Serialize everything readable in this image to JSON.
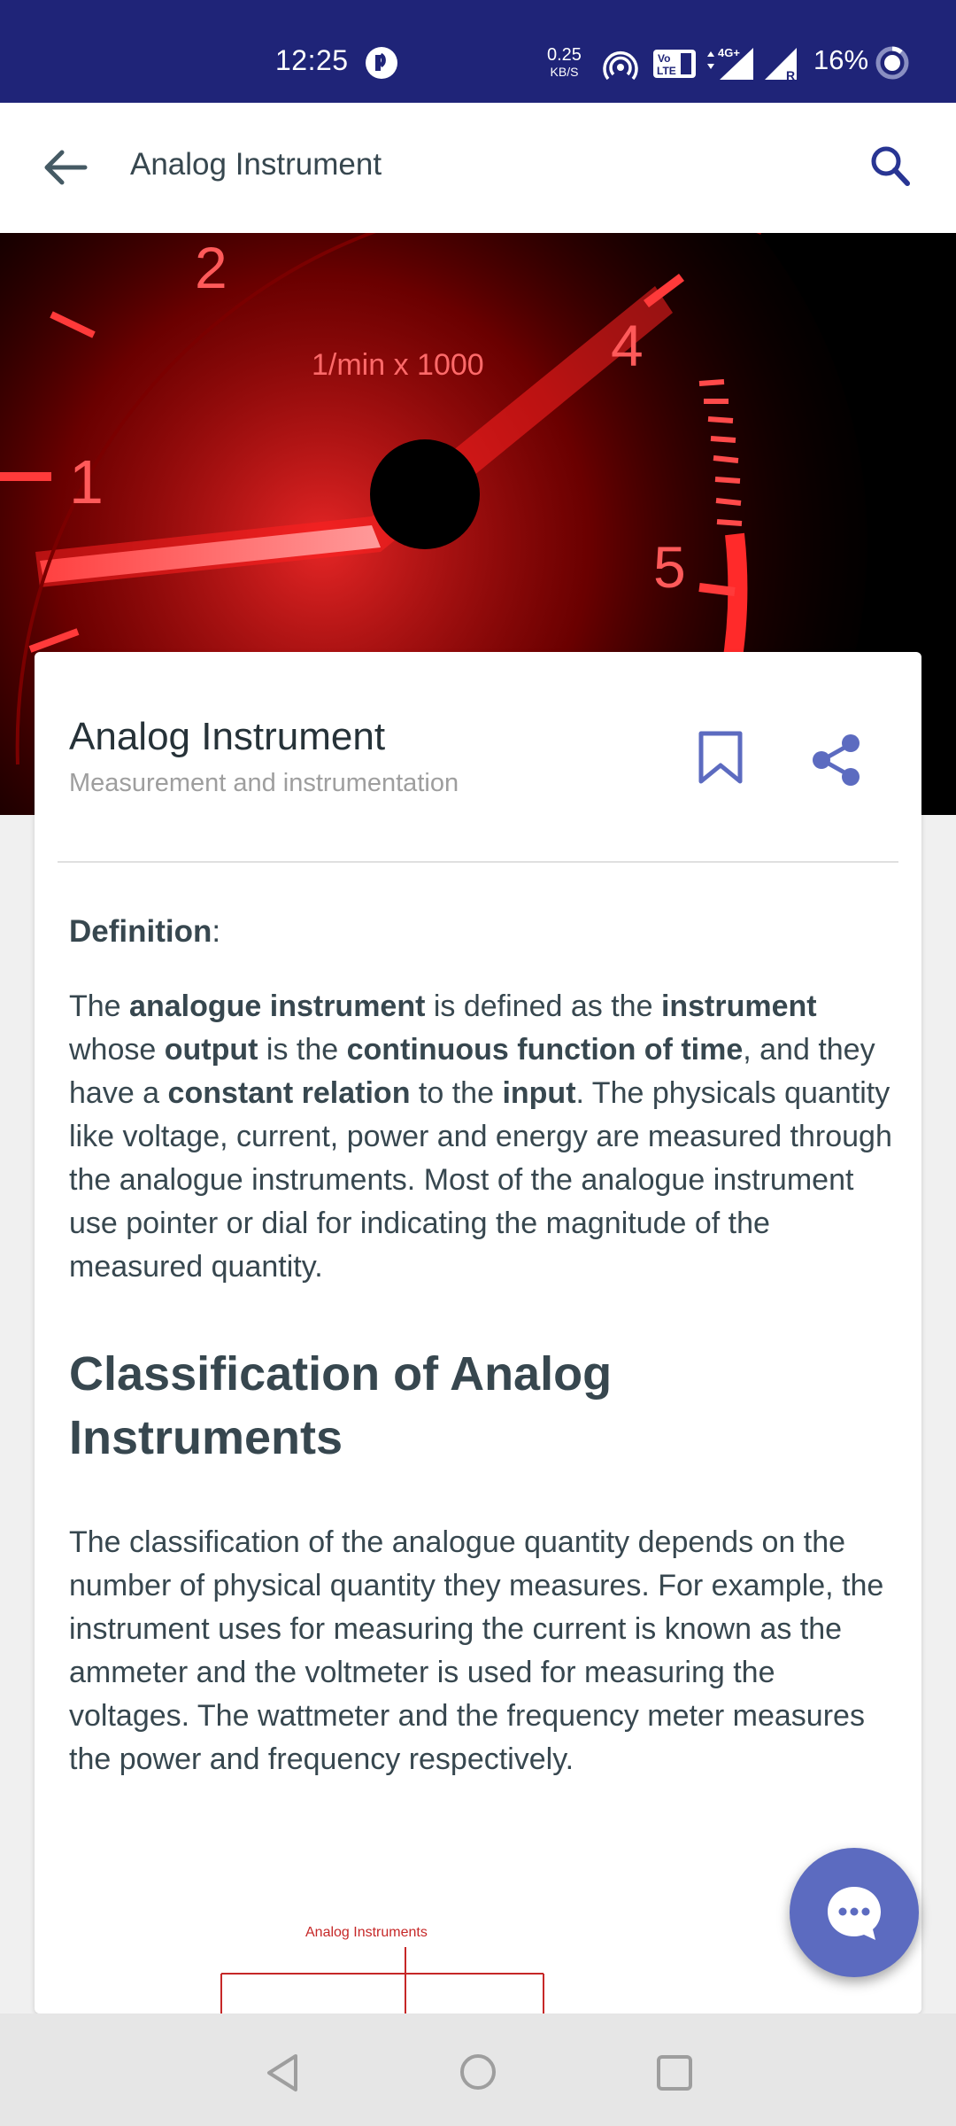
{
  "status_bar": {
    "time": "12:25",
    "speed_value": "0.25",
    "speed_unit": "KB/S",
    "battery_percent": "16%",
    "icons": [
      "notification-icon",
      "hotspot-icon",
      "volte-icon",
      "signal-4g-icon",
      "signal-r-icon",
      "battery-icon"
    ]
  },
  "app_bar": {
    "title": "Analog Instrument"
  },
  "hero": {
    "gauge_labels": [
      "2",
      "1",
      "4",
      "5"
    ],
    "unit": "1/min x 1000"
  },
  "card": {
    "title": "Analog Instrument",
    "subtitle": "Measurement and instrumentation"
  },
  "article": {
    "definition_label": "Definition",
    "definition_colon": ":",
    "para1": {
      "s1": "The ",
      "b1": "analogue instrument",
      "s2": " is defined as the ",
      "b2": "instrument",
      "s3": " whose ",
      "b3": "output",
      "s4": " is the ",
      "b4": "continuous function of time",
      "s5": ", and they have a ",
      "b5": "constant relation",
      "s6": " to the ",
      "b6": "input",
      "s7": ". The physicals quantity like voltage, current, power and energy are measured through the analogue instruments. Most of the analogue instrument use pointer or dial for indicating the magnitude of the measured quantity."
    },
    "heading": "Classification of Analog Instruments",
    "para2": "The classification of the analogue quantity depends on the number of physical quantity they measures. For example, the instrument uses for measuring the current is known as the ammeter and the voltmeter is used for measuring the voltages. The wattmeter and the frequency meter measures the power and frequency respectively.",
    "diagram_label": "Analog Instruments"
  },
  "colors": {
    "status_bar": "#1f2478",
    "accent": "#5c6bc0",
    "text": "#37474f"
  }
}
